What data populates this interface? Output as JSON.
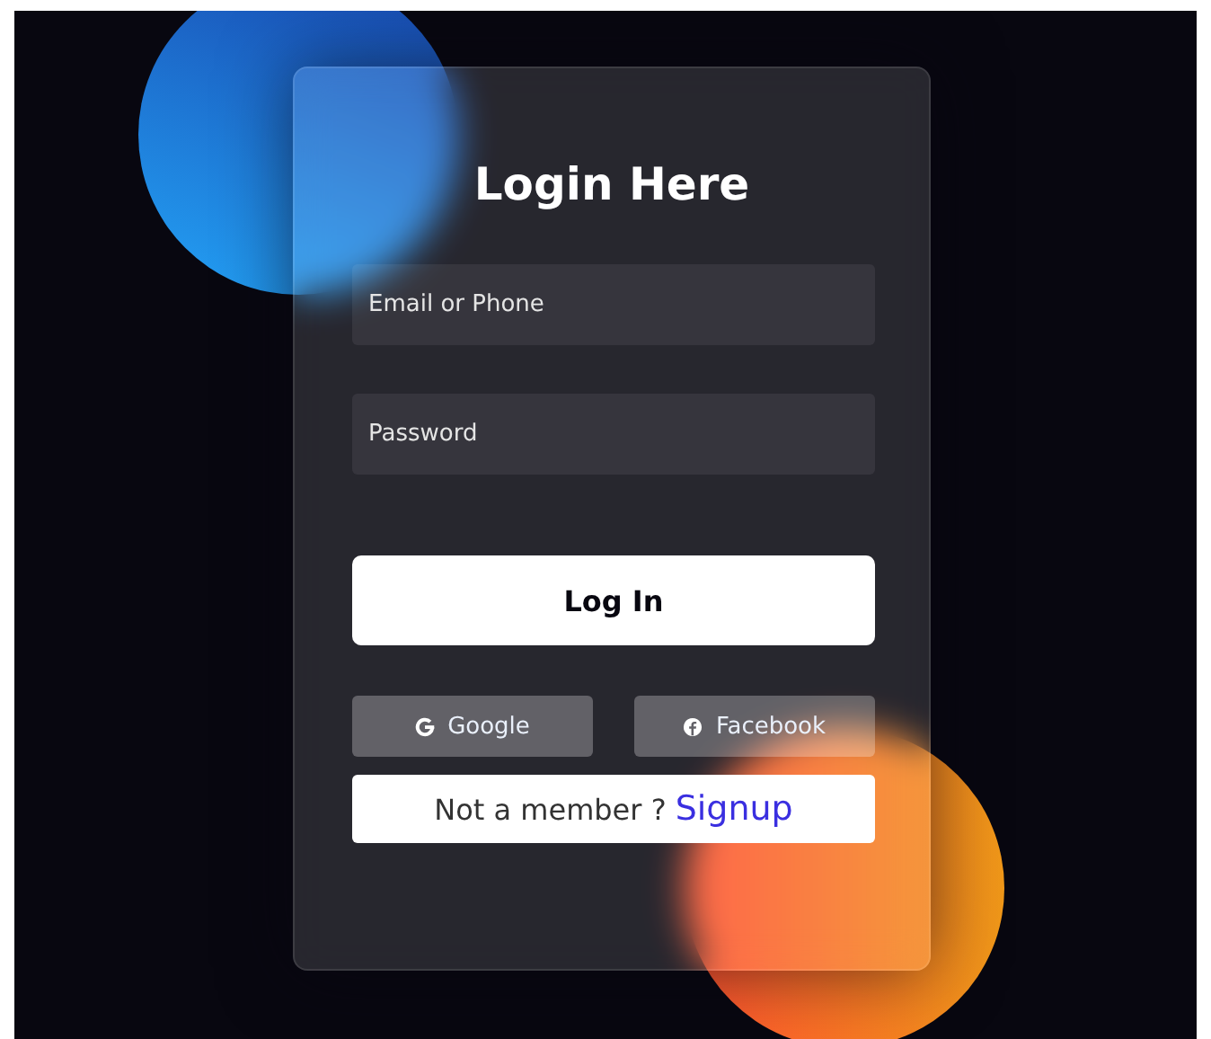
{
  "title": "Login Here",
  "fields": [
    {
      "placeholder": "Email or Phone"
    },
    {
      "placeholder": "Password"
    }
  ],
  "login_button": "Log In",
  "social_buttons": [
    {
      "kind": "google",
      "label": "Google"
    },
    {
      "kind": "facebook",
      "label": "Facebook"
    }
  ],
  "signup": {
    "prompt": "Not a member ?",
    "link": "Signup"
  }
}
